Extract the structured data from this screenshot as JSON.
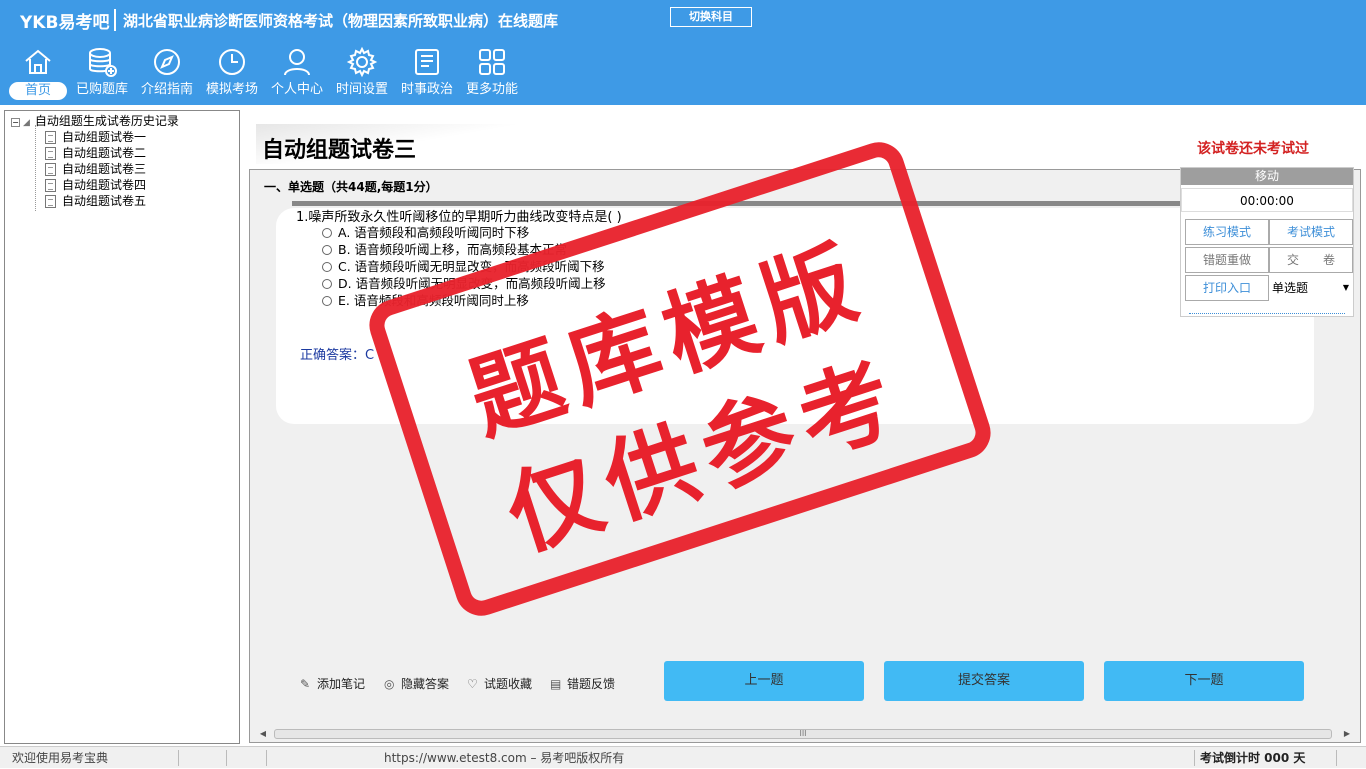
{
  "header": {
    "logo": "YKB易考吧",
    "title": "湖北省职业病诊断医师资格考试（物理因素所致职业病）在线题库",
    "switch_label": "切换科目"
  },
  "nav": [
    {
      "label": "首页",
      "icon": "home-icon"
    },
    {
      "label": "已购题库",
      "icon": "database-icon"
    },
    {
      "label": "介绍指南",
      "icon": "compass-icon"
    },
    {
      "label": "模拟考场",
      "icon": "clock-icon"
    },
    {
      "label": "个人中心",
      "icon": "user-icon"
    },
    {
      "label": "时间设置",
      "icon": "gear-icon"
    },
    {
      "label": "时事政治",
      "icon": "news-icon"
    },
    {
      "label": "更多功能",
      "icon": "grid-icon"
    }
  ],
  "tree": {
    "root": "自动组题生成试卷历史记录",
    "items": [
      "自动组题试卷一",
      "自动组题试卷二",
      "自动组题试卷三",
      "自动组题试卷四",
      "自动组题试卷五"
    ]
  },
  "main": {
    "paper_title": "自动组题试卷三",
    "status": "该试卷还未考试过",
    "section": "一、单选题（共44题,每题1分）",
    "question": "1.噪声所致永久性听阈移位的早期听力曲线改变特点是( )",
    "options": [
      "A. 语音频段和高频段听阈同时下移",
      "B. 语音频段听阈上移，而高频段基本正常",
      "C. 语音频段听阈无明显改变，而高频段听阈下移",
      "D. 语音频段听阈无明显改变，而高频段听阈上移",
      "E. 语音频段和高频段听阈同时上移"
    ],
    "answer": "正确答案：C",
    "bottom_links": [
      "添加笔记",
      "隐藏答案",
      "试题收藏",
      "错题反馈"
    ],
    "buttons": {
      "prev": "上一题",
      "submit": "提交答案",
      "next": "下一题"
    },
    "scroll_thumb": "III"
  },
  "side": {
    "move": "移动",
    "timer": "00:00:00",
    "practice": "练习模式",
    "exam": "考试模式",
    "redo": "错题重做",
    "hand_in": "交　　卷",
    "print": "打印入口",
    "type": "单选题"
  },
  "watermark": {
    "line1": "题库模版",
    "line2": "仅供参考"
  },
  "statusbar": {
    "welcome": "欢迎使用易考宝典",
    "copyright": "https://www.etest8.com – 易考吧版权所有",
    "countdown": "考试倒计时 000 天"
  }
}
